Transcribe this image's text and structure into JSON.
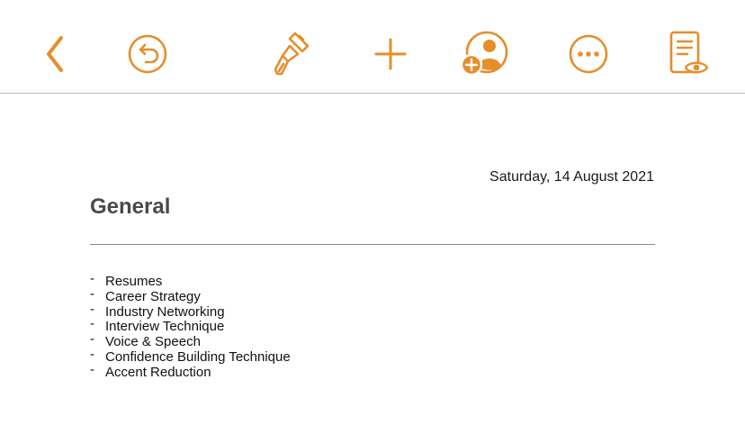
{
  "colors": {
    "accent": "#E58E2A",
    "text": "#111111",
    "title": "#4A4A4A",
    "rule": "#8A8A8A"
  },
  "toolbar": {
    "buttons": [
      {
        "name": "back-button",
        "icon": "chevron-left-icon"
      },
      {
        "name": "undo-button",
        "icon": "undo-icon"
      },
      {
        "name": "format-button",
        "icon": "paintbrush-icon"
      },
      {
        "name": "insert-button",
        "icon": "plus-icon"
      },
      {
        "name": "collaborate-button",
        "icon": "add-person-icon"
      },
      {
        "name": "more-button",
        "icon": "ellipsis-icon"
      },
      {
        "name": "reading-view-button",
        "icon": "document-eye-icon"
      }
    ]
  },
  "document": {
    "date": "Saturday, 14 August 2021",
    "title": "General",
    "bullet": "-",
    "items": [
      "Resumes",
      "Career Strategy",
      "Industry Networking",
      "Interview Technique",
      "Voice & Speech",
      "Confidence Building Technique",
      "Accent Reduction"
    ]
  }
}
